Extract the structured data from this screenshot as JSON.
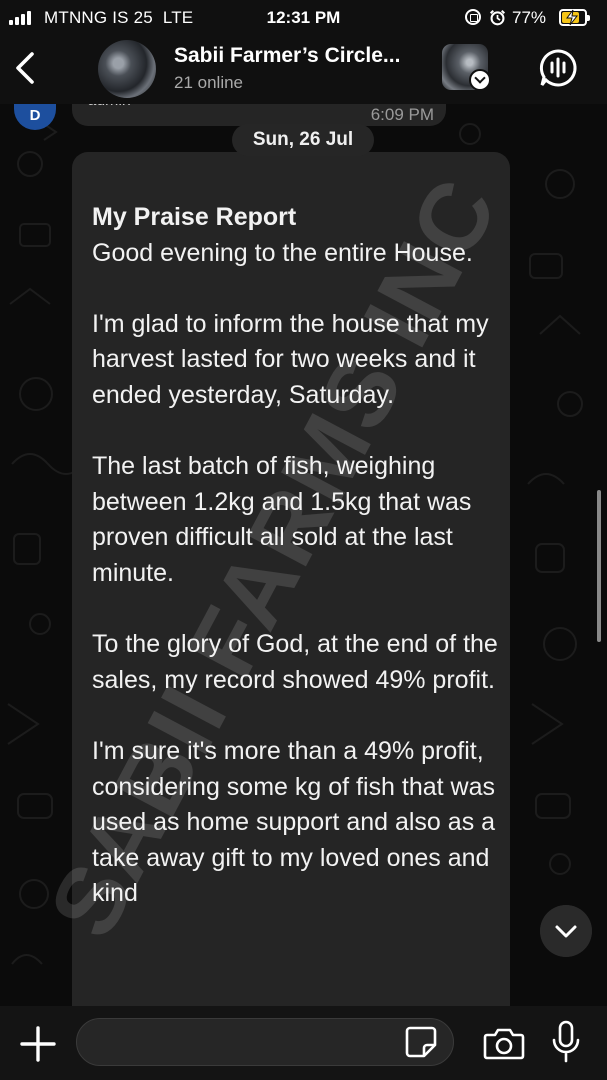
{
  "status_bar": {
    "carrier": "MTNNG IS 25",
    "network": "LTE",
    "time": "12:31 PM",
    "battery_percent": "77%",
    "battery_level": 0.77
  },
  "header": {
    "group_name": "Sabii Farmer’s Circle...",
    "online_status": "21 online"
  },
  "chat": {
    "previous_message": {
      "sender_initial": "D",
      "sender_name": "admin",
      "time": "6:09 PM"
    },
    "date_separator": "Sun, 26 Jul",
    "message": {
      "title": "My Praise Report",
      "paragraphs": [
        "Good evening to the entire House.",
        "I'm glad to inform the house that my harvest lasted for two weeks and it ended yesterday, Saturday.",
        "The last batch of fish, weighing between 1.2kg and 1.5kg that was proven difficult all sold at the last minute.",
        "To the glory of God, at the end of the sales, my record showed 49% profit.",
        "I'm sure it's more than a 49% profit, considering some kg of fish that was used as home support and also as a take away gift to my loved ones and kind"
      ]
    },
    "watermark": "SABII FARMS INC"
  },
  "input_bar": {
    "placeholder": ""
  },
  "icons": {
    "back": "chevron-left-icon",
    "voice_chat": "voice-chat-icon",
    "attach": "plus-icon",
    "sticker": "sticker-icon",
    "camera": "camera-icon",
    "mic": "microphone-icon",
    "scroll_down": "chevron-down-icon"
  },
  "colors": {
    "background": "#0b0b0b",
    "bubble": "#252525",
    "avatar_blue": "#1d4f9e",
    "battery_yellow": "#f5c518"
  }
}
